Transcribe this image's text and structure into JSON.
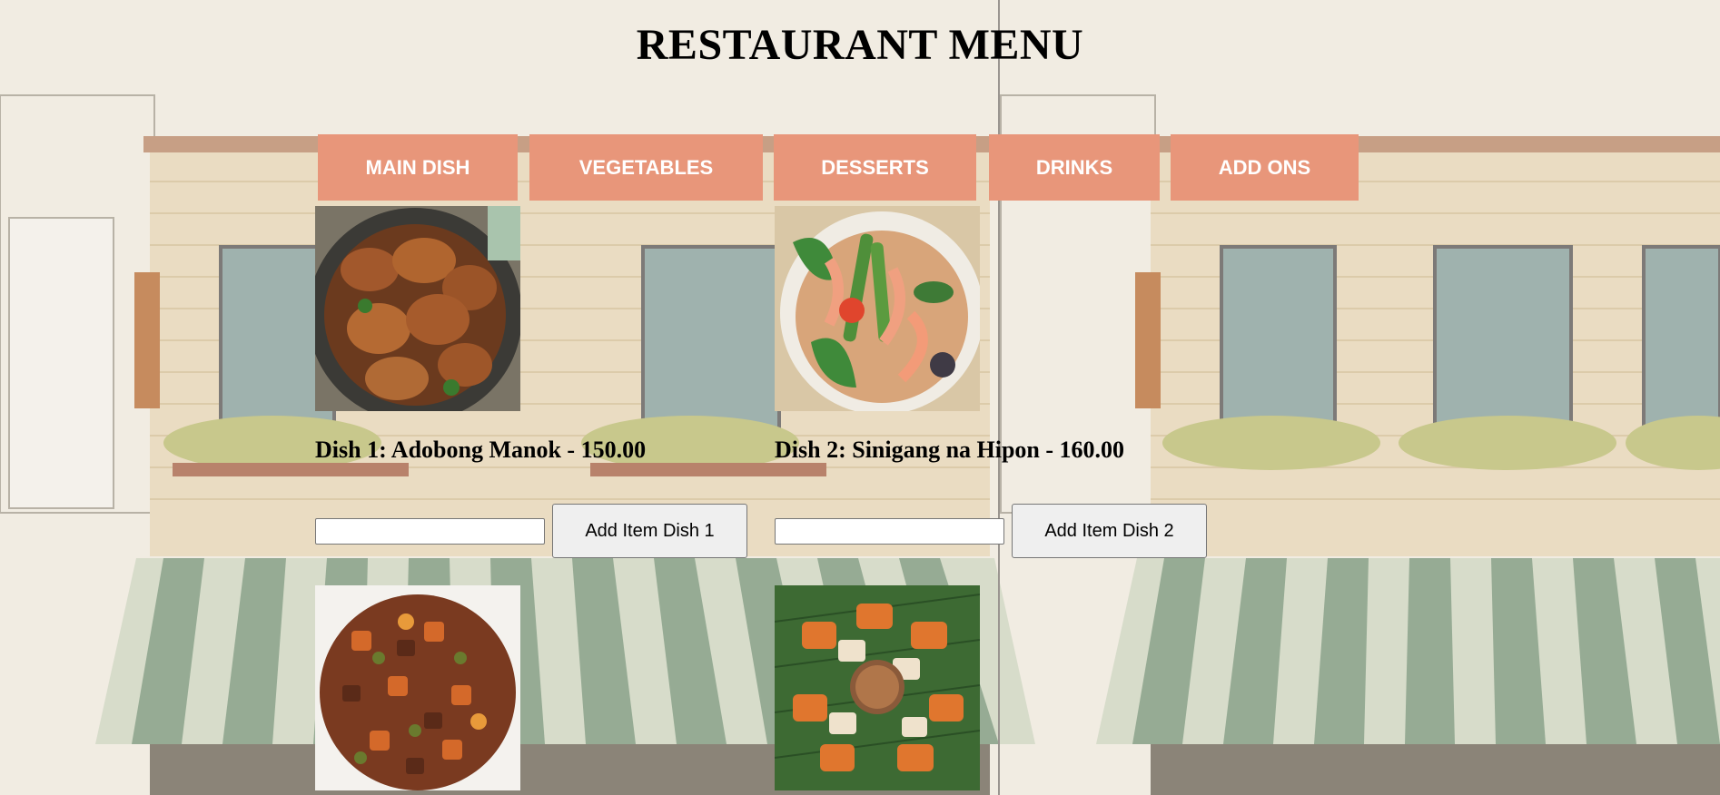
{
  "page": {
    "title": "RESTAURANT MENU",
    "colors": {
      "nav_tab_bg": "#e8967a",
      "nav_tab_text": "#ffffff",
      "background": "#f1ece2"
    }
  },
  "nav": {
    "tabs": [
      {
        "label": "MAIN DISH"
      },
      {
        "label": "VEGETABLES"
      },
      {
        "label": "DESSERTS"
      },
      {
        "label": "DRINKS"
      },
      {
        "label": "ADD ONS"
      }
    ]
  },
  "dishes": [
    {
      "label": "Dish 1: Adobong Manok - 150.00",
      "input_value": "",
      "button_label": "Add Item Dish 1",
      "image_icon": "adobong-manok-photo"
    },
    {
      "label": "Dish 2: Sinigang na Hipon - 160.00",
      "input_value": "",
      "button_label": "Add Item Dish 2",
      "image_icon": "sinigang-na-hipon-photo"
    },
    {
      "image_icon": "menudo-photo"
    },
    {
      "image_icon": "lechon-photo"
    }
  ]
}
